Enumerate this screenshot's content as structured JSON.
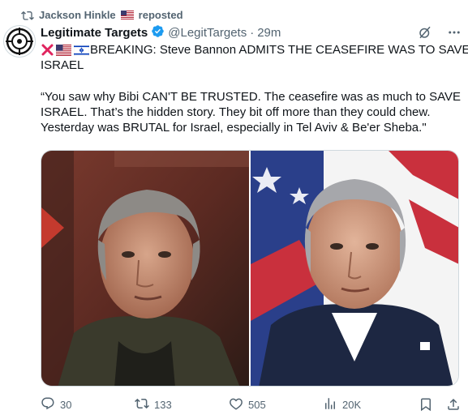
{
  "repost": {
    "user": "Jackson Hinkle",
    "label": "reposted"
  },
  "post": {
    "name": "Legitimate Targets",
    "handle": "@LegitTargets",
    "separator": "·",
    "time": "29m",
    "headline_line1": "BREAKING: Steve Bannon ADMITS THE CEASEFIRE WAS TO SAVE",
    "headline_line2": "ISRAEL",
    "quote_line1": "“You saw why Bibi CAN'T BE TRUSTED. The ceasefire was as much to SAVE",
    "quote_line2": "ISRAEL. That’s the hidden story. They bit off more than they could chew.",
    "quote_line3": "Yesterday was BRUTAL for Israel, especially in Tel Aviv & Be'er Sheba.\""
  },
  "media": {
    "left_photo": "Steve Bannon",
    "right_photo": "Benjamin Netanyahu"
  },
  "actions": {
    "replies": "30",
    "reposts": "133",
    "likes": "505",
    "views": "20K"
  },
  "icons": {
    "repost": "repost-icon",
    "verified": "verified-badge-icon",
    "grok": "grok-icon",
    "more": "more-icon",
    "reply": "reply-icon",
    "like": "heart-icon",
    "views": "views-icon",
    "bookmark": "bookmark-icon",
    "share": "share-icon"
  },
  "colors": {
    "text": "#0f1419",
    "secondary": "#536471",
    "verified": "#1d9bf0",
    "cross": "#e0245e"
  }
}
